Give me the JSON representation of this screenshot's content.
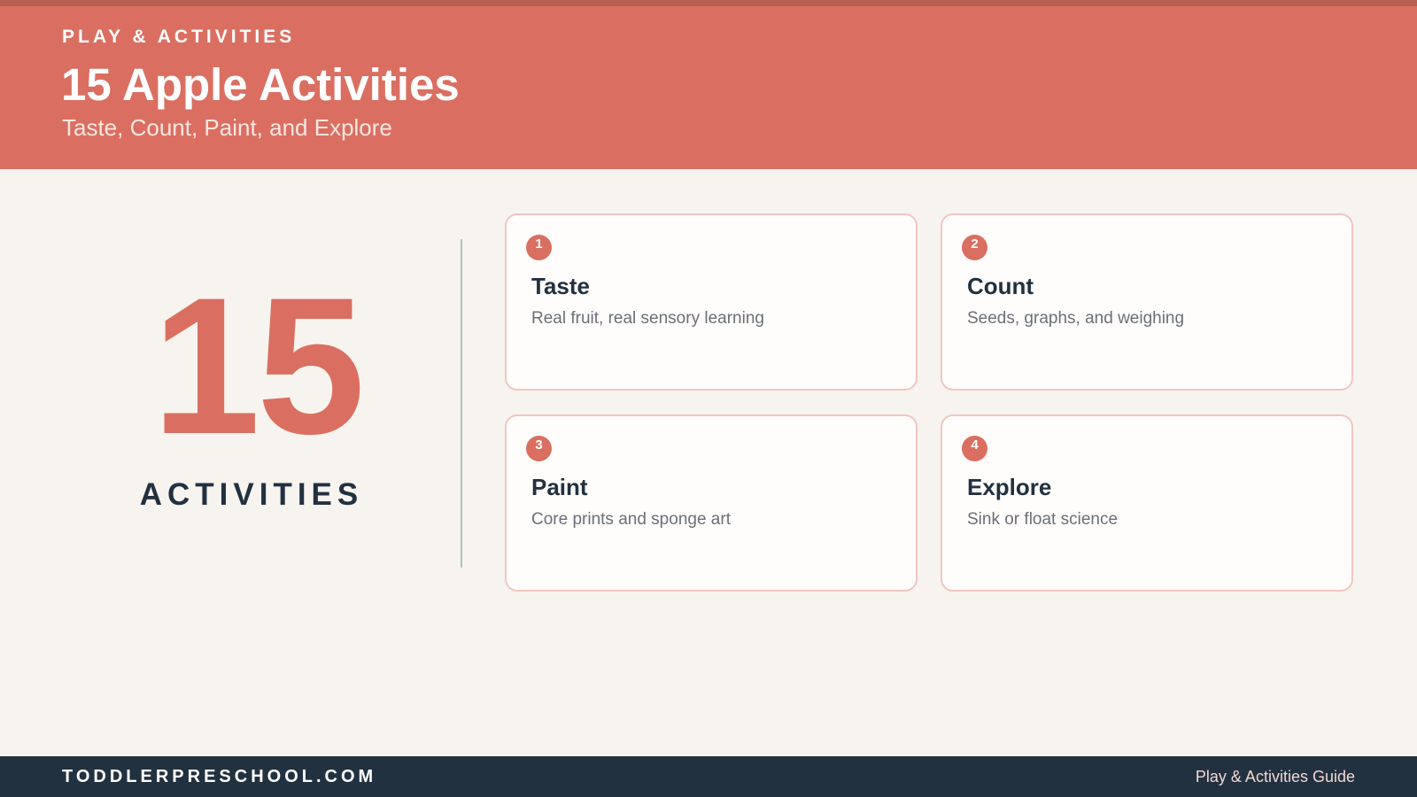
{
  "header": {
    "eyebrow": "PLAY & ACTIVITIES",
    "title": "15 Apple Activities",
    "subtitle": "Taste, Count, Paint, and Explore"
  },
  "summary": {
    "count": "15",
    "label": "ACTIVITIES"
  },
  "cards": [
    {
      "number": "1",
      "title": "Taste",
      "description": "Real fruit, real sensory learning"
    },
    {
      "number": "2",
      "title": "Count",
      "description": "Seeds, graphs, and weighing"
    },
    {
      "number": "3",
      "title": "Paint",
      "description": "Core prints and sponge art"
    },
    {
      "number": "4",
      "title": "Explore",
      "description": "Sink or float science"
    }
  ],
  "footer": {
    "site": "TODDLERPRESCHOOL.COM",
    "guide": "Play & Activities Guide"
  },
  "colors": {
    "accent": "#da6f61",
    "dark": "#223140",
    "background": "#f7f3ef",
    "divider": "#a9c9b1"
  }
}
